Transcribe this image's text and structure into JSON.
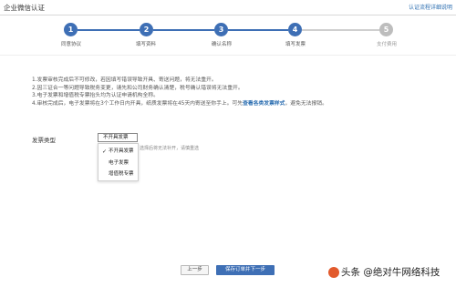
{
  "header": {
    "title": "企业微信认证",
    "help_link": "认证流程详细说明"
  },
  "steps": [
    {
      "number": "1",
      "label": "同意协议",
      "done": true
    },
    {
      "number": "2",
      "label": "填写资料",
      "done": true
    },
    {
      "number": "3",
      "label": "确认名称",
      "done": true
    },
    {
      "number": "4",
      "label": "填写发票",
      "done": true
    },
    {
      "number": "5",
      "label": "支付费用",
      "done": false
    }
  ],
  "notes": {
    "line1": "1.发票审核完成后不可修改，若因填写错误导致开具、寄送问题，将无法重开。",
    "line2": "2.因三证合一等问题导致税务变更，请先和公司财务确认清楚，税号确认错误将无法重开。",
    "line3": "3.电子发票和增值税专票抬头均为认证申请机构全称。",
    "line4_pre": "4.审核完成后，电子发票将在3个工作日内开具，纸质发票将在45天内寄送至你手上。可先",
    "line4_link": "查看各类发票样式",
    "line4_post": "，避免无法报销。"
  },
  "invoice": {
    "label": "发票类型",
    "selected": "不开具发票",
    "hint": "选择后将无法补开，请慎重选",
    "options": [
      "不开具发票",
      "电子发票",
      "增值税专票"
    ]
  },
  "buttons": {
    "prev": "上一步",
    "next": "保存订单并下一步"
  },
  "watermark": "头条 @绝对牛网络科技"
}
